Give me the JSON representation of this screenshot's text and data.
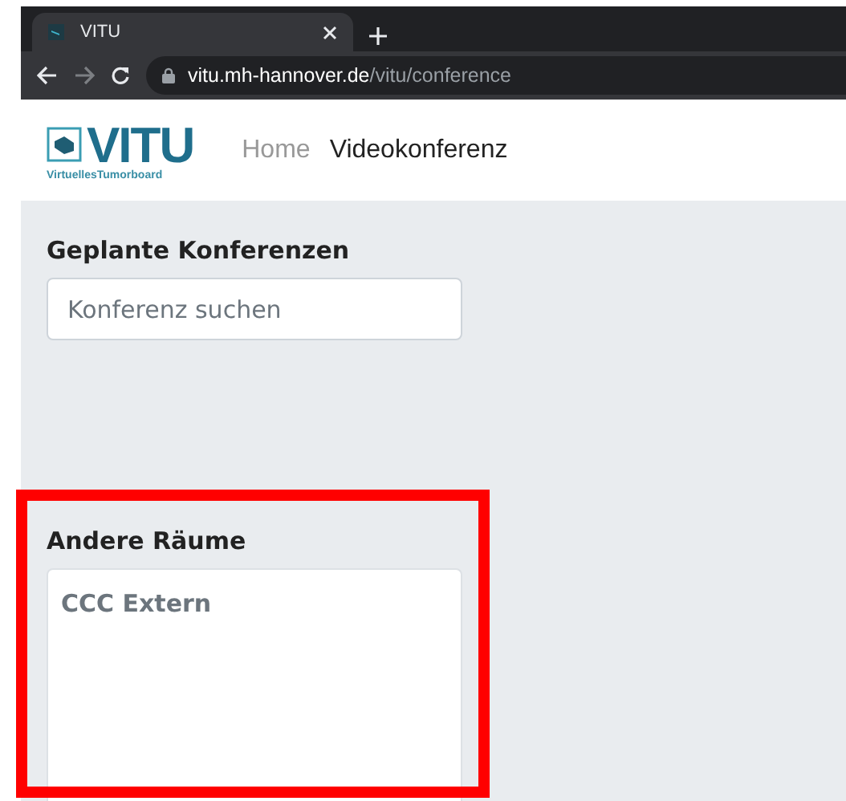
{
  "browser": {
    "tab": {
      "title": "VITU"
    },
    "url_host": "vitu.mh-hannover.de",
    "url_path": "/vitu/conference"
  },
  "navbar": {
    "logo": {
      "title": "VITU",
      "subtitle": "VirtuellesTumorboard"
    },
    "links": [
      {
        "label": "Home",
        "selected": false
      },
      {
        "label": "Videokonferenz",
        "selected": true
      }
    ]
  },
  "planned": {
    "heading": "Geplante Konferenzen",
    "search": {
      "placeholder": "Konferenz suchen"
    }
  },
  "other_rooms": {
    "heading": "Andere Räume",
    "rooms": [
      {
        "name": "CCC Extern"
      }
    ],
    "highlighted": true
  }
}
